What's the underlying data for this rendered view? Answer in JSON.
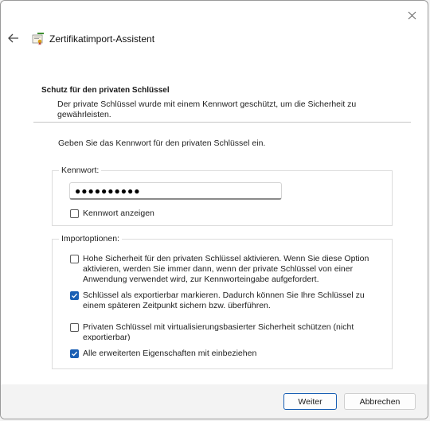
{
  "window": {
    "title": "Zertifikatimport-Assistent"
  },
  "header": {
    "title": "Schutz für den privaten Schlüssel",
    "description": "Der private Schlüssel wurde mit einem Kennwort geschützt, um die Sicherheit zu gewährleisten."
  },
  "prompt": "Geben Sie das Kennwort für den privaten Schlüssel ein.",
  "password_group": {
    "label": "Kennwort:",
    "value": "●●●●●●●●●●",
    "show_password_label": "Kennwort anzeigen",
    "show_password_checked": false
  },
  "import_options": {
    "label": "Importoptionen:",
    "options": [
      {
        "label": "Hohe Sicherheit für den privaten Schlüssel aktivieren. Wenn Sie diese Option aktivieren, werden Sie immer dann, wenn der private Schlüssel von einer Anwendung verwendet wird, zur Kennworteingabe aufgefordert.",
        "checked": false
      },
      {
        "label": "Schlüssel als exportierbar markieren. Dadurch können Sie Ihre Schlüssel zu einem späteren Zeitpunkt sichern bzw. überführen.",
        "checked": true
      },
      {
        "label": "Privaten Schlüssel mit virtualisierungsbasierter Sicherheit schützen (nicht exportierbar)",
        "checked": false
      },
      {
        "label": "Alle erweiterten Eigenschaften mit einbeziehen",
        "checked": true
      }
    ]
  },
  "buttons": {
    "next": "Weiter",
    "cancel": "Abbrechen"
  },
  "colors": {
    "accent": "#1a5fb4"
  }
}
